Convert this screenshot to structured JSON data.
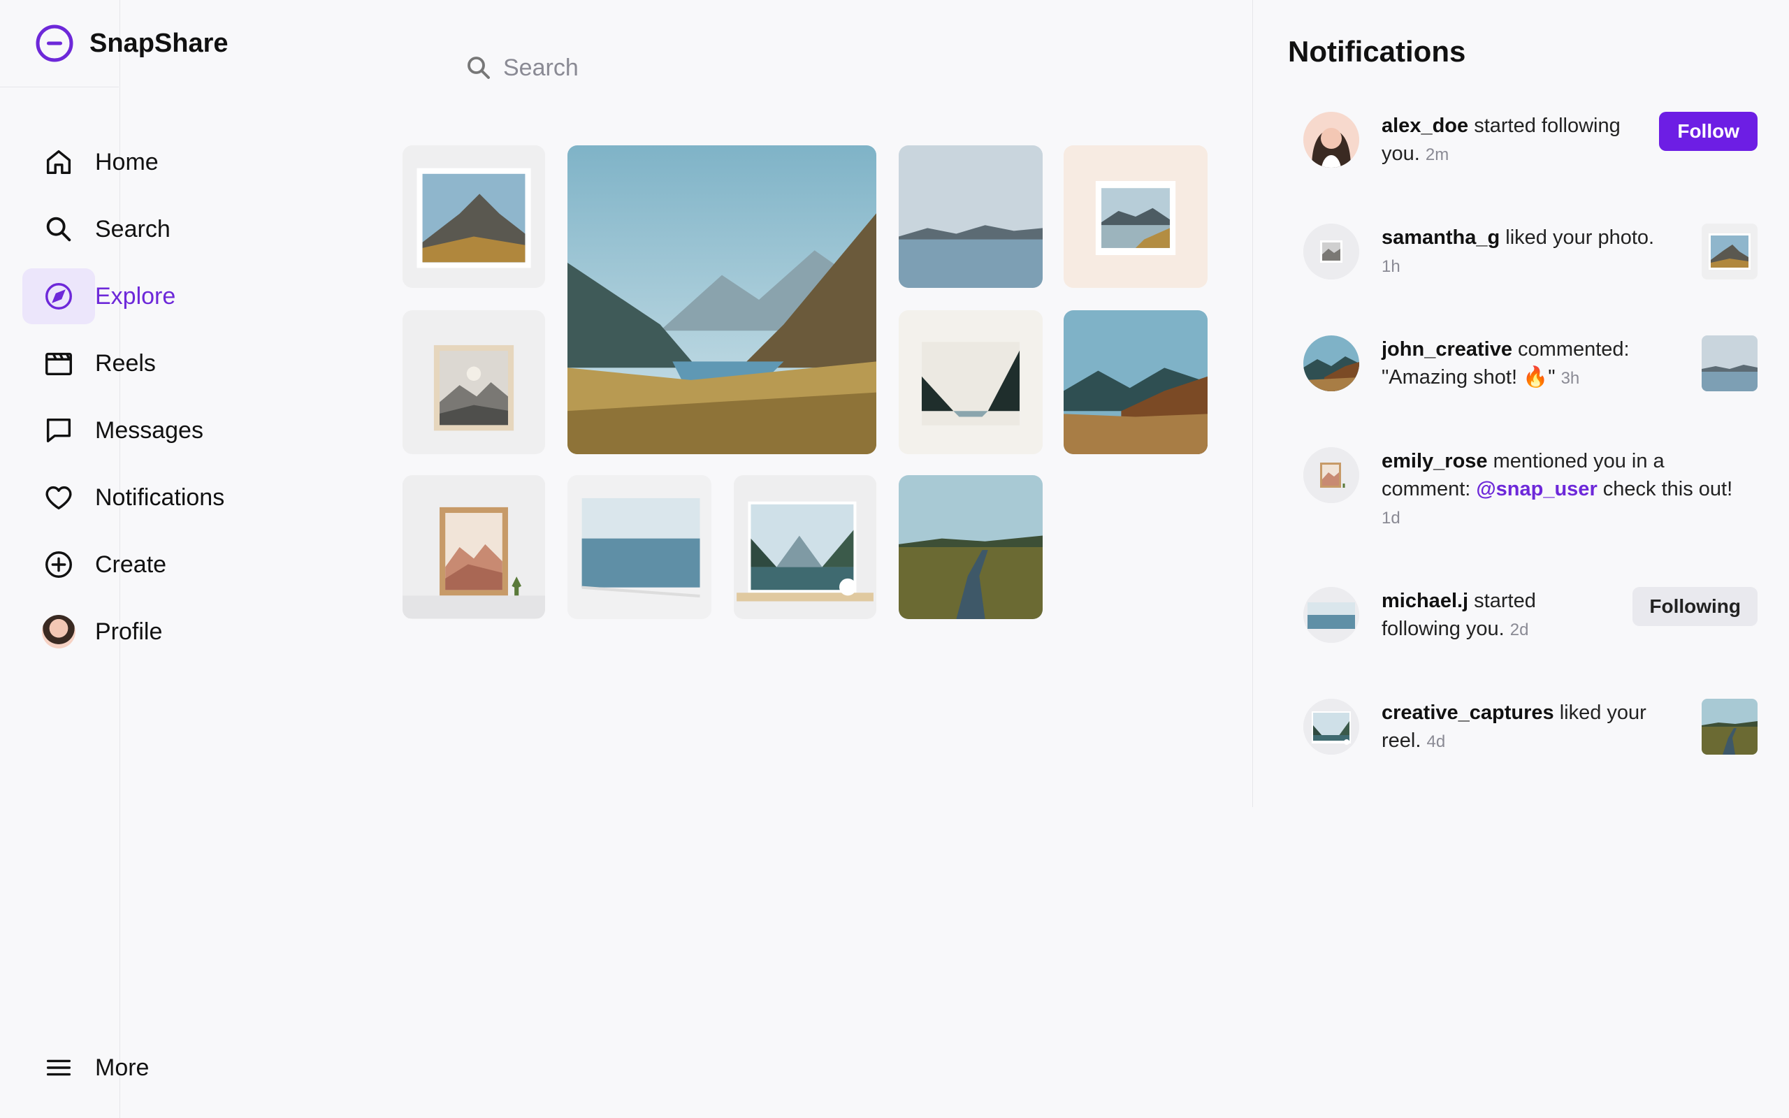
{
  "app": {
    "name": "SnapShare",
    "accent": "#6d28d9"
  },
  "nav": {
    "items": [
      {
        "label": "Home",
        "icon": "home-icon"
      },
      {
        "label": "Search",
        "icon": "search-icon"
      },
      {
        "label": "Explore",
        "icon": "compass-icon",
        "active": true
      },
      {
        "label": "Reels",
        "icon": "clapperboard-icon"
      },
      {
        "label": "Messages",
        "icon": "message-icon"
      },
      {
        "label": "Notifications",
        "icon": "heart-icon"
      },
      {
        "label": "Create",
        "icon": "plus-circle-icon"
      },
      {
        "label": "Profile",
        "icon": "avatar"
      }
    ],
    "more": {
      "label": "More",
      "icon": "menu-icon"
    }
  },
  "search": {
    "placeholder": "Search"
  },
  "notifications": {
    "title": "Notifications",
    "items": [
      {
        "user": "alex_doe",
        "text": " started following you.",
        "time": "2m",
        "action": "Follow"
      },
      {
        "user": "samantha_g",
        "text": " liked your photo.",
        "time": "1h"
      },
      {
        "user": "john_creative",
        "text": " commented: \"Amazing shot! 🔥\"",
        "time": "3h"
      },
      {
        "user": "emily_rose",
        "text_before": " mentioned you in a comment: ",
        "mention": "@snap_user",
        "text_after": " check this out!",
        "time": "1d"
      },
      {
        "user": "michael.j",
        "text": " started following you.",
        "time": "2d",
        "action": "Following"
      },
      {
        "user": "creative_captures",
        "text": " liked your reel.",
        "time": "4d"
      }
    ]
  }
}
